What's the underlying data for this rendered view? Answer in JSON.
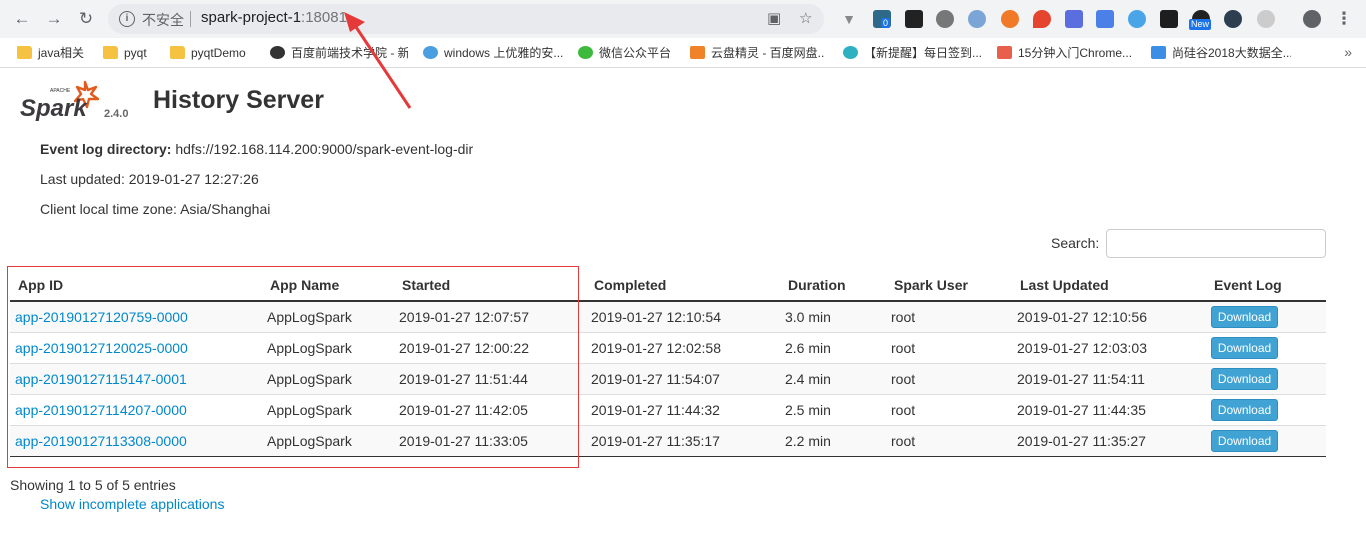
{
  "browser": {
    "security_label": "不安全",
    "url_host": "spark-project-1",
    "url_port": ":18081",
    "bookmarks": [
      {
        "label": "java相关",
        "icon": "folder-icon"
      },
      {
        "label": "pyqt",
        "icon": "folder-icon"
      },
      {
        "label": "pyqtDemo",
        "icon": "folder-icon"
      },
      {
        "label": "百度前端技术学院 - 新...",
        "icon": "site-icon"
      },
      {
        "label": "windows 上优雅的安...",
        "icon": "site-icon"
      },
      {
        "label": "微信公众平台",
        "icon": "wechat-icon"
      },
      {
        "label": "云盘精灵 - 百度网盘...",
        "icon": "site-icon"
      },
      {
        "label": "【新提醒】每日签到...",
        "icon": "site-icon"
      },
      {
        "label": "15分钟入门Chrome...",
        "icon": "site-icon"
      },
      {
        "label": "尚硅谷2018大数据全...",
        "icon": "share-icon"
      }
    ],
    "ext_badge_new": "New",
    "ext_badge_zero": "0"
  },
  "page": {
    "logo_text": "Spark",
    "logo_sub": "APACHE",
    "version": "2.4.0",
    "title": "History Server",
    "event_log_dir_label": "Event log directory:",
    "event_log_dir_value": "hdfs://192.168.114.200:9000/spark-event-log-dir",
    "last_updated": "Last updated: 2019-01-27 12:27:26",
    "timezone": "Client local time zone: Asia/Shanghai",
    "search_label": "Search:",
    "search_value": ""
  },
  "table": {
    "headers": [
      "App ID",
      "App Name",
      "Started",
      "Completed",
      "Duration",
      "Spark User",
      "Last Updated",
      "Event Log"
    ],
    "rows": [
      {
        "app_id": "app-20190127120759-0000",
        "app_name": "AppLogSpark",
        "started": "2019-01-27 12:07:57",
        "completed": "2019-01-27 12:10:54",
        "duration": "3.0 min",
        "user": "root",
        "last_updated": "2019-01-27 12:10:56",
        "event_log": "Download"
      },
      {
        "app_id": "app-20190127120025-0000",
        "app_name": "AppLogSpark",
        "started": "2019-01-27 12:00:22",
        "completed": "2019-01-27 12:02:58",
        "duration": "2.6 min",
        "user": "root",
        "last_updated": "2019-01-27 12:03:03",
        "event_log": "Download"
      },
      {
        "app_id": "app-20190127115147-0001",
        "app_name": "AppLogSpark",
        "started": "2019-01-27 11:51:44",
        "completed": "2019-01-27 11:54:07",
        "duration": "2.4 min",
        "user": "root",
        "last_updated": "2019-01-27 11:54:11",
        "event_log": "Download"
      },
      {
        "app_id": "app-20190127114207-0000",
        "app_name": "AppLogSpark",
        "started": "2019-01-27 11:42:05",
        "completed": "2019-01-27 11:44:32",
        "duration": "2.5 min",
        "user": "root",
        "last_updated": "2019-01-27 11:44:35",
        "event_log": "Download"
      },
      {
        "app_id": "app-20190127113308-0000",
        "app_name": "AppLogSpark",
        "started": "2019-01-27 11:33:05",
        "completed": "2019-01-27 11:35:17",
        "duration": "2.2 min",
        "user": "root",
        "last_updated": "2019-01-27 11:35:27",
        "event_log": "Download"
      }
    ]
  },
  "footer": {
    "showing": "Showing 1 to 5 of 5 entries",
    "incomplete_link": "Show incomplete applications"
  },
  "colors": {
    "link": "#0088cc",
    "button": "#41a3d3",
    "annotation": "#e53a3a"
  }
}
